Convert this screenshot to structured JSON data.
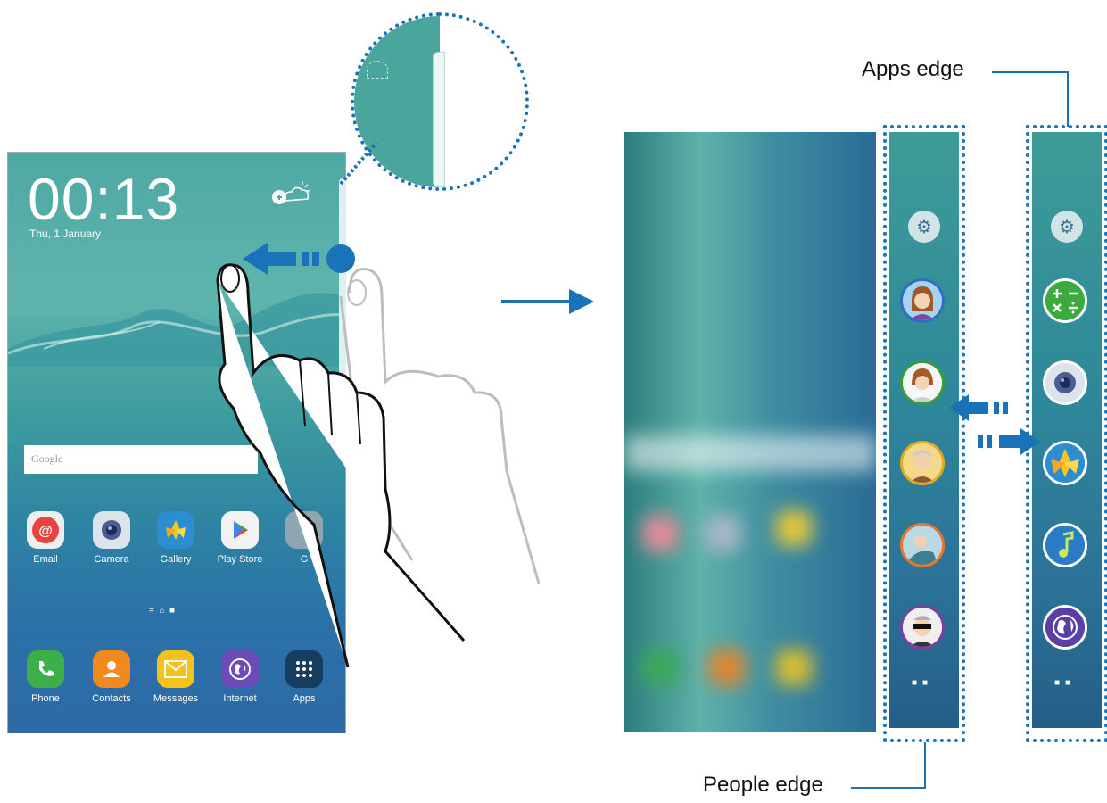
{
  "lock_screen": {
    "time": "00:13",
    "date": "Thu, 1 January"
  },
  "search": {
    "placeholder": "Google"
  },
  "home_apps": [
    {
      "label": "Email",
      "color": "#e8e8e8",
      "icon": "email-icon"
    },
    {
      "label": "Camera",
      "color": "#dde3ea",
      "icon": "camera-icon"
    },
    {
      "label": "Gallery",
      "color": "#2c8ed0",
      "icon": "gallery-icon"
    },
    {
      "label": "Play Store",
      "color": "#f2f2f2",
      "icon": "play-store-icon"
    },
    {
      "label": "G",
      "color": "#888888",
      "icon": "app-icon"
    }
  ],
  "dock_apps": [
    {
      "label": "Phone",
      "color": "#3caf4a",
      "icon": "phone-icon"
    },
    {
      "label": "Contacts",
      "color": "#f08a1e",
      "icon": "contacts-icon"
    },
    {
      "label": "Messages",
      "color": "#f3c21b",
      "icon": "messages-icon"
    },
    {
      "label": "Internet",
      "color": "#6c4ab8",
      "icon": "internet-icon"
    },
    {
      "label": "Apps",
      "color": "#173d5e",
      "icon": "apps-grid-icon"
    }
  ],
  "callouts": {
    "apps_edge": "Apps edge",
    "people_edge": "People edge"
  },
  "people_edge": {
    "contacts": [
      {
        "border": "#2f6ec2",
        "icon": "contact-avatar-icon"
      },
      {
        "border": "#3a9a3c",
        "icon": "contact-avatar-icon"
      },
      {
        "border": "#e3a91c",
        "icon": "contact-avatar-icon"
      },
      {
        "border": "#e8772b",
        "icon": "contact-avatar-icon"
      },
      {
        "border": "#7a3fa1",
        "icon": "contact-avatar-icon"
      }
    ]
  },
  "apps_edge": {
    "apps": [
      {
        "icon": "calculator-icon",
        "color": "#3caa3c"
      },
      {
        "icon": "camera-icon",
        "color": "#dde3ea"
      },
      {
        "icon": "gallery-icon",
        "color": "#2c8ed0"
      },
      {
        "icon": "music-icon",
        "color": "#2a7cc7"
      },
      {
        "icon": "internet-icon",
        "color": "#5a3fa6"
      }
    ]
  },
  "colors": {
    "accent": "#1a72b8"
  }
}
